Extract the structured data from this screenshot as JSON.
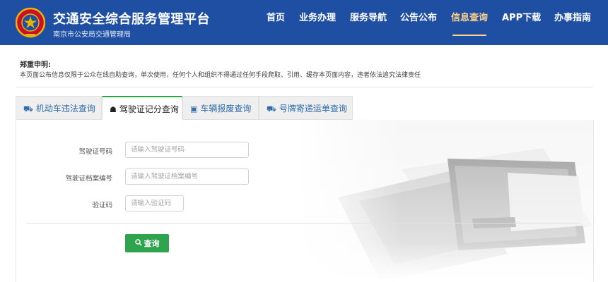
{
  "header": {
    "title": "交通安全综合服务管理平台",
    "subtitle": "南京市公安局交通管理局",
    "nav": [
      {
        "label": "首页"
      },
      {
        "label": "业务办理"
      },
      {
        "label": "服务导航"
      },
      {
        "label": "公告公布"
      },
      {
        "label": "信息查询",
        "active": true
      },
      {
        "label": "APP下载"
      },
      {
        "label": "办事指南"
      }
    ]
  },
  "disclaimer": {
    "title": "郑重申明:",
    "text": "本页面公布信息仅限于公众在线自助查询，单次使用，任何个人和组织不得通过任何手段爬取、引用、缓存本页面内容，违者依法追究法律责任"
  },
  "tabs": [
    {
      "icon": "⛟",
      "label": "机动车违法查询"
    },
    {
      "icon": "☗",
      "label": "驾驶证记分查询",
      "active": true
    },
    {
      "icon": "▣",
      "label": "车辆报废查询"
    },
    {
      "icon": "⛟",
      "label": "号牌寄递运单查询"
    }
  ],
  "form": {
    "license_number": {
      "label": "驾驶证号码",
      "placeholder": "请输入驾驶证号码"
    },
    "file_number": {
      "label": "驾驶证档案编号",
      "placeholder": "请输入驾驶证档案编号"
    },
    "captcha": {
      "label": "验证码",
      "placeholder": "请输入验证码"
    },
    "submit": {
      "icon": "🔍",
      "label": "查询"
    }
  },
  "colors": {
    "header_bg": "#1f4fa3",
    "nav_active": "#ffd28a",
    "button_green": "#2ea44f",
    "tab_text": "#2e6ba8"
  }
}
